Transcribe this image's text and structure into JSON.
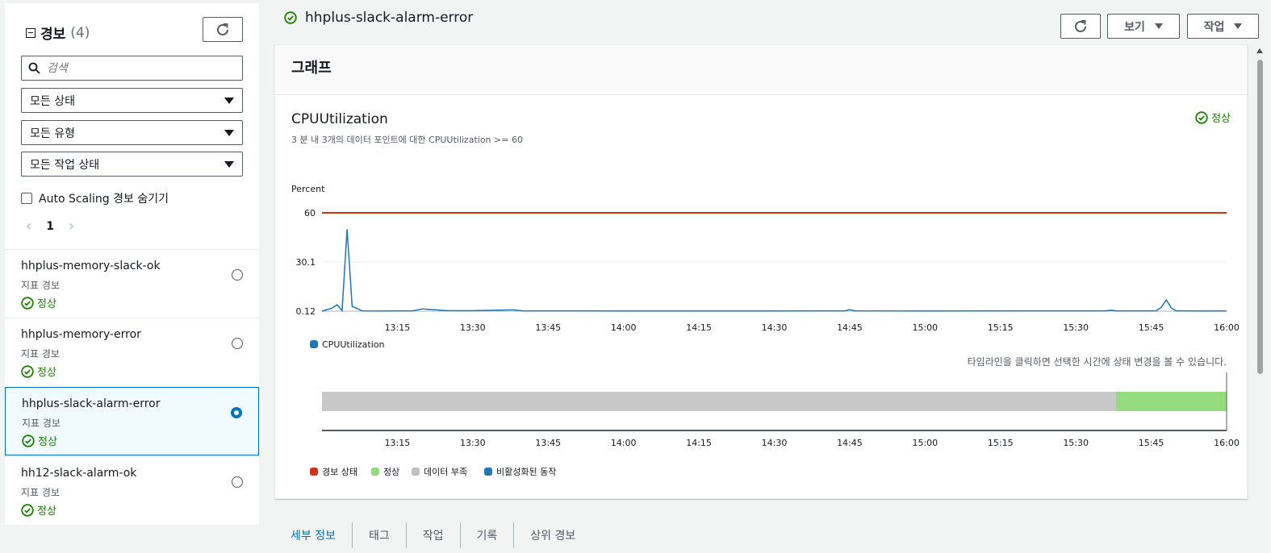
{
  "sidebar": {
    "title": "경보",
    "count": "(4)",
    "search_placeholder": "검색",
    "filters": {
      "state": "모든 상태",
      "type": "모든 유형",
      "action_state": "모든 작업 상태"
    },
    "hide_autoscaling_label": "Auto Scaling 경보 숨기기",
    "page": "1",
    "alarms": [
      {
        "name": "hhplus-memory-slack-ok",
        "type": "지표 경보",
        "status": "정상",
        "selected": false
      },
      {
        "name": "hhplus-memory-error",
        "type": "지표 경보",
        "status": "정상",
        "selected": false
      },
      {
        "name": "hhplus-slack-alarm-error",
        "type": "지표 경보",
        "status": "정상",
        "selected": true
      },
      {
        "name": "hh12-slack-alarm-ok",
        "type": "지표 경보",
        "status": "정상",
        "selected": false
      }
    ]
  },
  "header": {
    "alarm_name": "hhplus-slack-alarm-error",
    "view_label": "보기",
    "actions_label": "작업"
  },
  "panel": {
    "title": "그래프",
    "metric": "CPUUtilization",
    "condition": "3 분 내 3개의 데이터 포인트에 대한 CPUUtilization >= 60",
    "status": "정상",
    "timeline_note": "타임라인을 클릭하면 선택한 시간에 상태 변경을 볼 수 있습니다."
  },
  "chart_data": {
    "type": "line",
    "ylabel": "Percent",
    "y_ticks": [
      "60",
      "30.1",
      "0.12"
    ],
    "ylim": [
      0.12,
      60
    ],
    "x_ticks": [
      "13:15",
      "13:30",
      "13:45",
      "14:00",
      "14:15",
      "14:30",
      "14:45",
      "15:00",
      "15:15",
      "15:30",
      "15:45",
      "16:00"
    ],
    "threshold": 60,
    "threshold_color": "#d13212",
    "series": [
      {
        "name": "CPUUtilization",
        "color": "#1f77b4",
        "x": [
          "13:00",
          "13:02",
          "13:03",
          "13:04",
          "13:05",
          "13:06",
          "13:08",
          "13:12",
          "13:18",
          "13:20",
          "13:25",
          "13:30",
          "13:38",
          "13:40",
          "13:50",
          "14:00",
          "14:30",
          "14:44",
          "14:45",
          "14:46",
          "15:00",
          "15:30",
          "15:36",
          "15:37",
          "15:38",
          "15:46",
          "15:47",
          "15:48",
          "15:49",
          "15:50",
          "15:52",
          "15:55",
          "16:00"
        ],
        "values": [
          0.12,
          2.0,
          4.0,
          0.5,
          50.0,
          3.0,
          0.3,
          0.2,
          0.3,
          1.5,
          0.4,
          0.4,
          0.9,
          0.3,
          0.3,
          0.2,
          0.2,
          0.3,
          1.0,
          0.3,
          0.2,
          0.3,
          0.3,
          0.8,
          0.3,
          0.3,
          2.5,
          7.0,
          2.0,
          0.3,
          0.3,
          0.2,
          0.2
        ]
      }
    ],
    "legend": [
      "CPUUtilization"
    ],
    "timeline": {
      "x_ticks": [
        "13:15",
        "13:30",
        "13:45",
        "14:00",
        "14:15",
        "14:30",
        "14:45",
        "15:00",
        "15:15",
        "15:30",
        "15:45",
        "16:00"
      ],
      "segments": [
        {
          "state": "데이터 부족",
          "start": "13:00",
          "end": "15:38",
          "color": "#c8c8c8"
        },
        {
          "state": "정상",
          "start": "15:38",
          "end": "16:00",
          "color": "#95dc80"
        }
      ],
      "legend": [
        {
          "label": "경보 상태",
          "color": "#d13212"
        },
        {
          "label": "정상",
          "color": "#95dc80"
        },
        {
          "label": "데이터 부족",
          "color": "#c0c0c0"
        },
        {
          "label": "비활성화된 동작",
          "color": "#1f77b4"
        }
      ]
    }
  },
  "tabs": [
    {
      "label": "세부 정보",
      "active": true
    },
    {
      "label": "태그",
      "active": false
    },
    {
      "label": "작업",
      "active": false
    },
    {
      "label": "기록",
      "active": false
    },
    {
      "label": "상위 경보",
      "active": false
    }
  ]
}
